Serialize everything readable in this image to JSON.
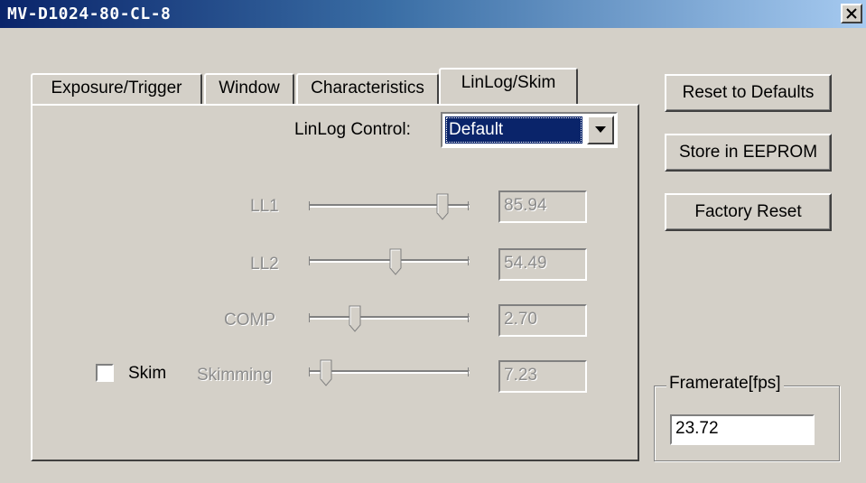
{
  "window": {
    "title": "MV-D1024-80-CL-8",
    "close_label": "close"
  },
  "tabs": [
    {
      "label": "Exposure/Trigger",
      "active": false
    },
    {
      "label": "Window",
      "active": false
    },
    {
      "label": "Characteristics",
      "active": false
    },
    {
      "label": "LinLog/Skim",
      "active": true
    }
  ],
  "linlog": {
    "control_label": "LinLog Control:",
    "control_value": "Default",
    "sliders": [
      {
        "label": "LL1",
        "value": "85.94",
        "fraction": 0.8594
      },
      {
        "label": "LL2",
        "value": "54.49",
        "fraction": 0.5449
      },
      {
        "label": "COMP",
        "value": "2.70",
        "fraction": 0.27
      },
      {
        "label": "Skimming",
        "value": "7.23",
        "fraction": 0.0723
      }
    ],
    "skim": {
      "label": "Skim",
      "checked": false
    }
  },
  "buttons": {
    "reset_defaults": "Reset to Defaults",
    "store_eeprom": "Store in EEPROM",
    "factory_reset": "Factory Reset"
  },
  "framerate": {
    "label": "Framerate[fps]",
    "value": "23.72"
  },
  "colors": {
    "face": "#d4d0c8",
    "title_start": "#0a246a",
    "title_end": "#a6caf0",
    "selection": "#0a246a",
    "disabled_text": "#8c8c8c"
  }
}
